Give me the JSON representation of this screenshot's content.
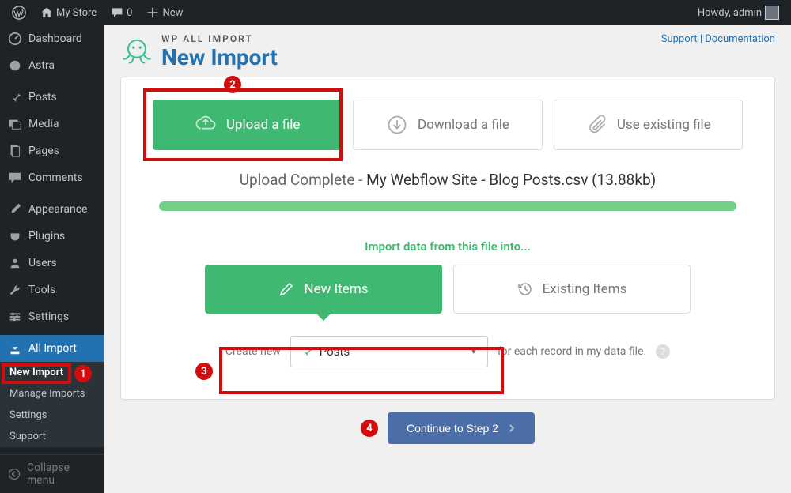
{
  "toolbar": {
    "site_name": "My Store",
    "comments": "0",
    "new_label": "New",
    "greeting": "Howdy, admin"
  },
  "sidebar": {
    "items": [
      {
        "icon": "dashboard",
        "label": "Dashboard"
      },
      {
        "icon": "astra",
        "label": "Astra"
      },
      {
        "icon": "pin",
        "label": "Posts"
      },
      {
        "icon": "media",
        "label": "Media"
      },
      {
        "icon": "page",
        "label": "Pages"
      },
      {
        "icon": "comment",
        "label": "Comments"
      },
      {
        "icon": "appearance",
        "label": "Appearance"
      },
      {
        "icon": "plugin",
        "label": "Plugins"
      },
      {
        "icon": "users",
        "label": "Users"
      },
      {
        "icon": "tools",
        "label": "Tools"
      },
      {
        "icon": "settings",
        "label": "Settings"
      },
      {
        "icon": "import",
        "label": "All Import"
      }
    ],
    "sub": [
      {
        "label": "New Import",
        "active": true
      },
      {
        "label": "Manage Imports"
      },
      {
        "label": "Settings"
      },
      {
        "label": "Support"
      }
    ],
    "collapse": "Collapse menu"
  },
  "header": {
    "brand_small": "WP ALL IMPORT",
    "brand_large": "New Import",
    "support": "Support",
    "docs": "Documentation"
  },
  "file_options": {
    "upload": "Upload a file",
    "download": "Download a file",
    "existing": "Use existing file"
  },
  "status": {
    "prefix": "Upload Complete",
    "sep": " - ",
    "file": "My Webflow Site - Blog Posts.csv",
    "size": "(13.88kb)"
  },
  "into_label": "Import data from this file into...",
  "modes": {
    "new": "New Items",
    "existing": "Existing Items"
  },
  "create": {
    "prefix": "Create new",
    "value": "Posts",
    "suffix": "for each record in my data file."
  },
  "continue": "Continue to Step 2",
  "annotations": {
    "a1": "1",
    "a2": "2",
    "a3": "3",
    "a4": "4"
  }
}
